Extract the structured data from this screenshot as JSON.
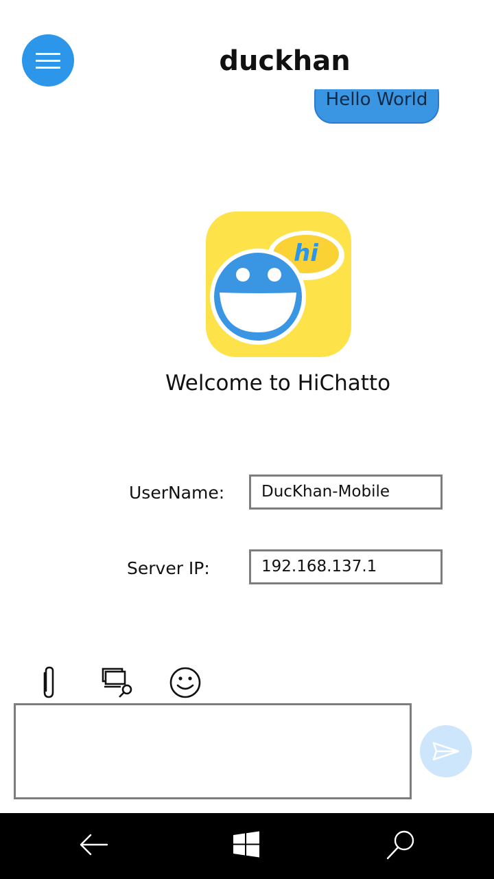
{
  "header": {
    "menu_icon": "hamburger-menu-icon",
    "title": "duckhan"
  },
  "chat": {
    "messages": [
      {
        "text": "Hello World",
        "sender": "self"
      }
    ]
  },
  "welcome": {
    "logo_text": "hi",
    "text": "Welcome to HiChatto"
  },
  "form": {
    "username_label": "UserName:",
    "username_value": "DucKhan-Mobile",
    "server_ip_label": "Server IP:",
    "server_ip_value": "192.168.137.1"
  },
  "composer": {
    "tools": [
      "paperclip-icon",
      "image-search-icon",
      "smiley-icon"
    ],
    "message_value": "",
    "send_icon": "send-icon"
  },
  "system_nav": {
    "icons": [
      "back-arrow-icon",
      "windows-icon",
      "search-icon"
    ]
  },
  "colors": {
    "accent": "#2b96ea",
    "bubble": "#3a96e3",
    "logo_bg": "#fde349",
    "send_disabled": "#cde6fb",
    "field_border": "#7d7d7d"
  }
}
